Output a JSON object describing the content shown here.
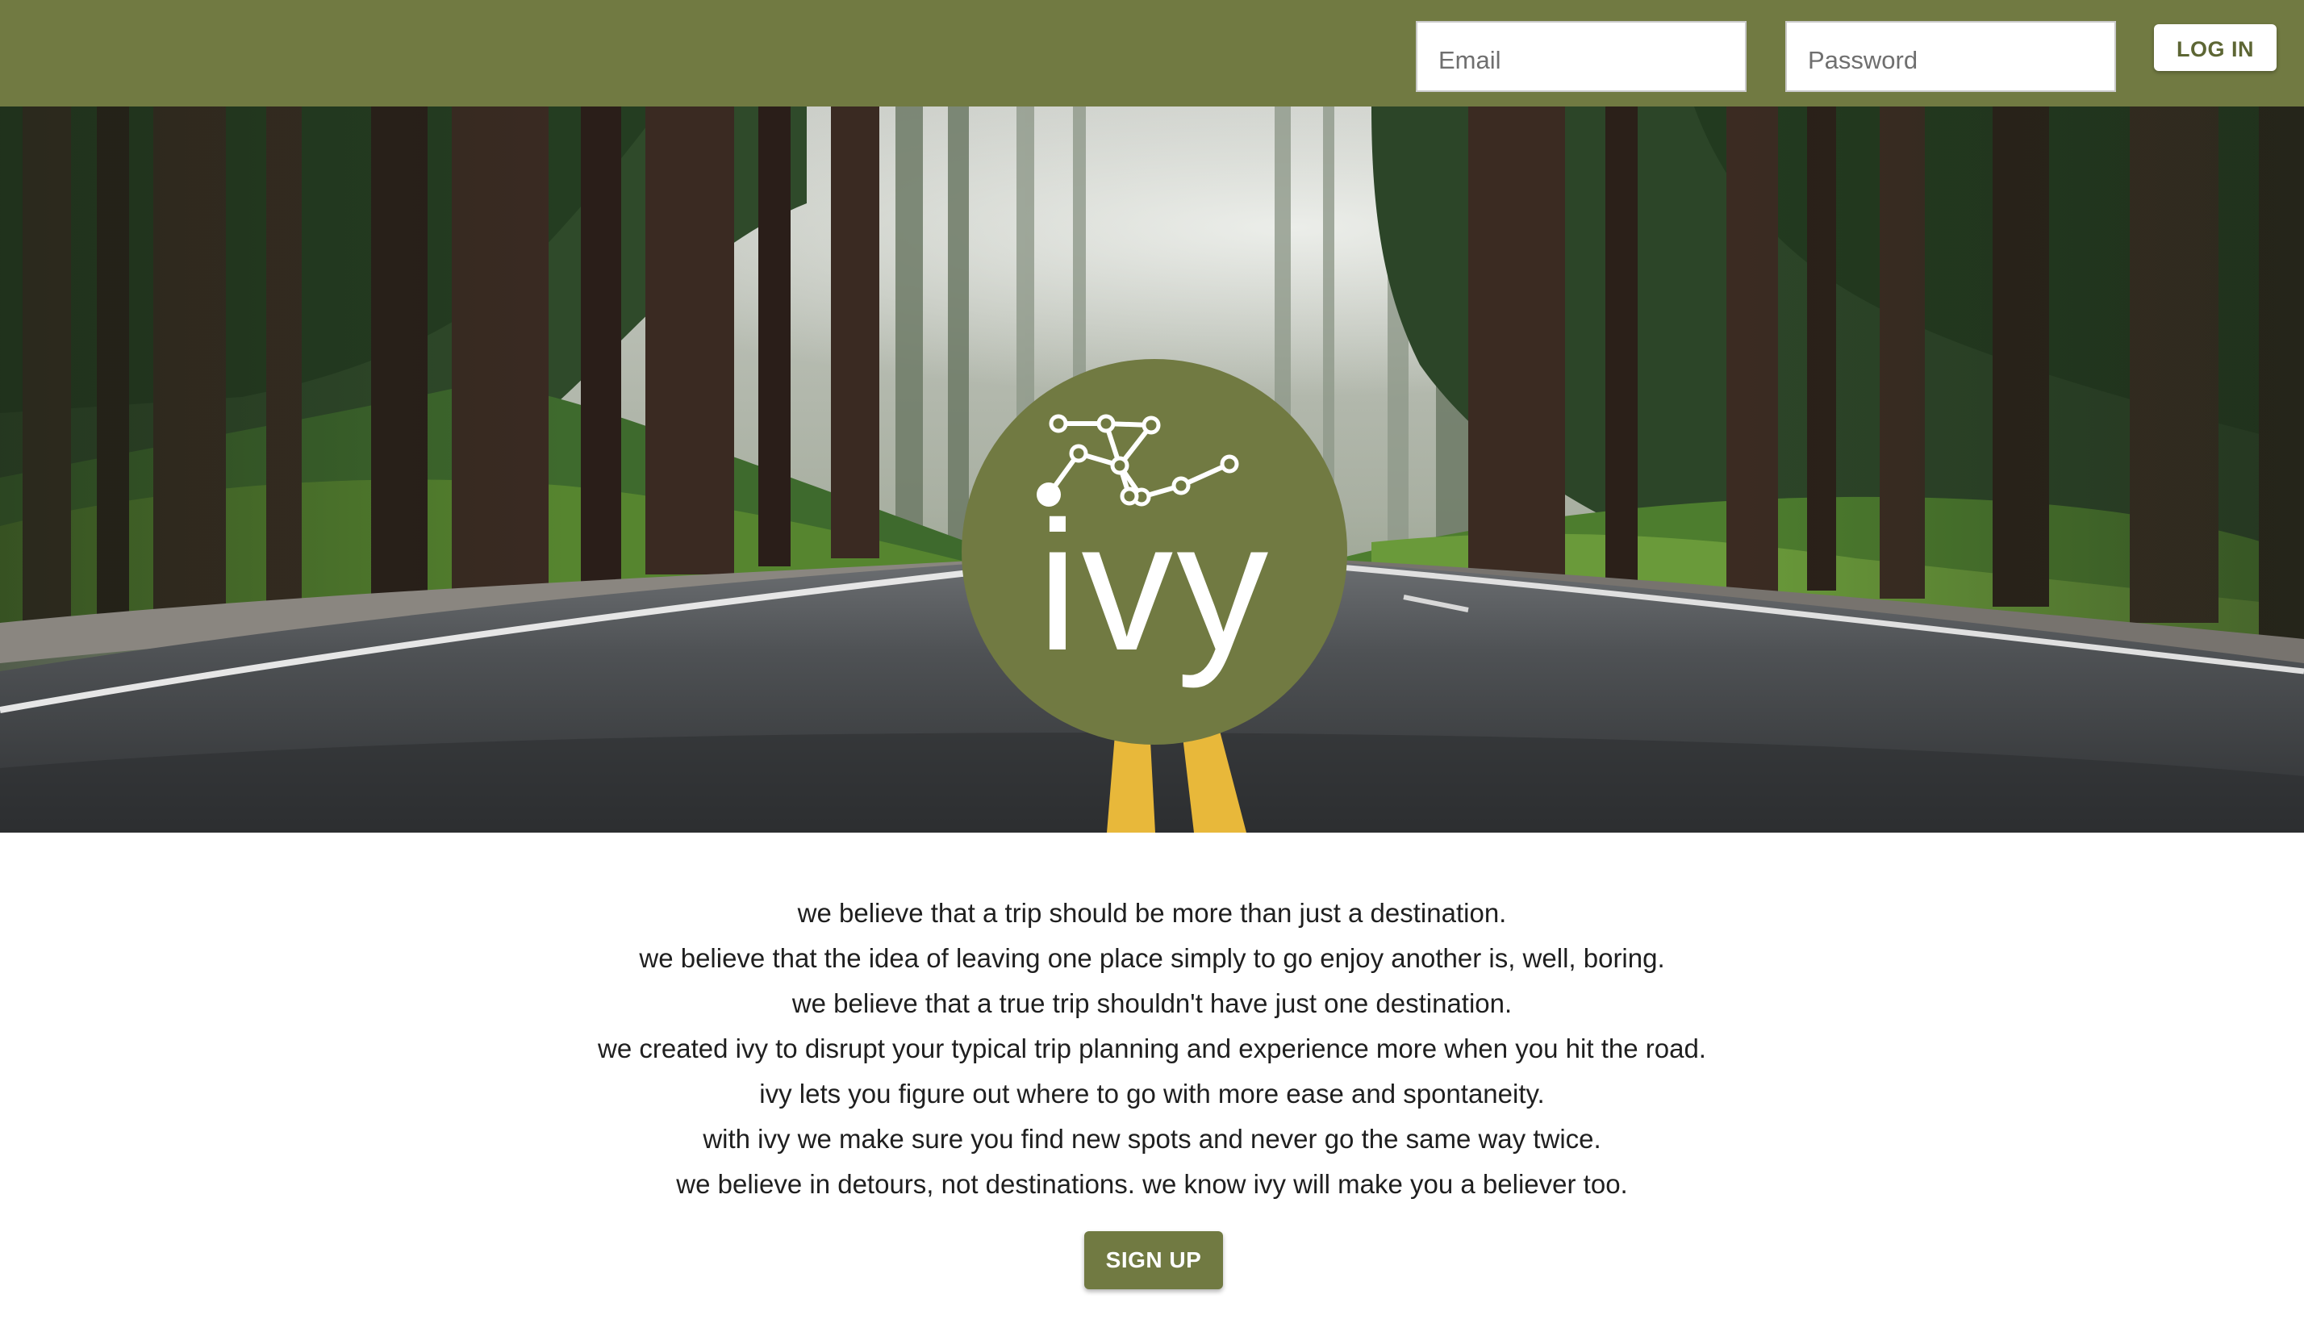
{
  "header": {
    "email_placeholder": "Email",
    "password_placeholder": "Password",
    "login_label": "LOG IN"
  },
  "hero": {
    "logo_text": "ivy",
    "background_image": "forest-road-photo"
  },
  "copy": {
    "lines": [
      "we believe that a trip should be more than just a destination.",
      "we believe that the idea of leaving one place simply to go enjoy another is, well, boring.",
      "we believe that a true trip shouldn't have just one destination.",
      "we created ivy to disrupt your typical trip planning and experience more when you hit the road.",
      "ivy lets you figure out where to go with more ease and spontaneity.",
      "with ivy we make sure you find new spots and never go the same way twice.",
      "we believe in detours, not destinations. we know ivy will make you a believer too."
    ]
  },
  "signup_label": "SIGN UP",
  "colors": {
    "brand_olive": "#717a42",
    "text": "#1f1f1f",
    "background": "#ffffff"
  },
  "icons": {
    "logo_mark": "route-network-icon"
  }
}
